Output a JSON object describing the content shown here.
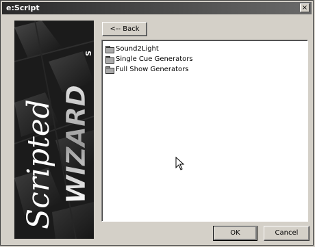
{
  "window": {
    "title": "e:Script",
    "close_label": "×"
  },
  "banner": {
    "script_text": "Scripted",
    "wizard_text": "WIZARD",
    "suffix_text": "S"
  },
  "toolbar": {
    "back_label": "<-- Back"
  },
  "list": {
    "items": [
      {
        "label": "Sound2Light",
        "icon": "folder-icon"
      },
      {
        "label": "Single Cue Generators",
        "icon": "folder-icon"
      },
      {
        "label": "Full Show Generators",
        "icon": "folder-icon"
      }
    ]
  },
  "footer": {
    "ok_label": "OK",
    "cancel_label": "Cancel"
  }
}
